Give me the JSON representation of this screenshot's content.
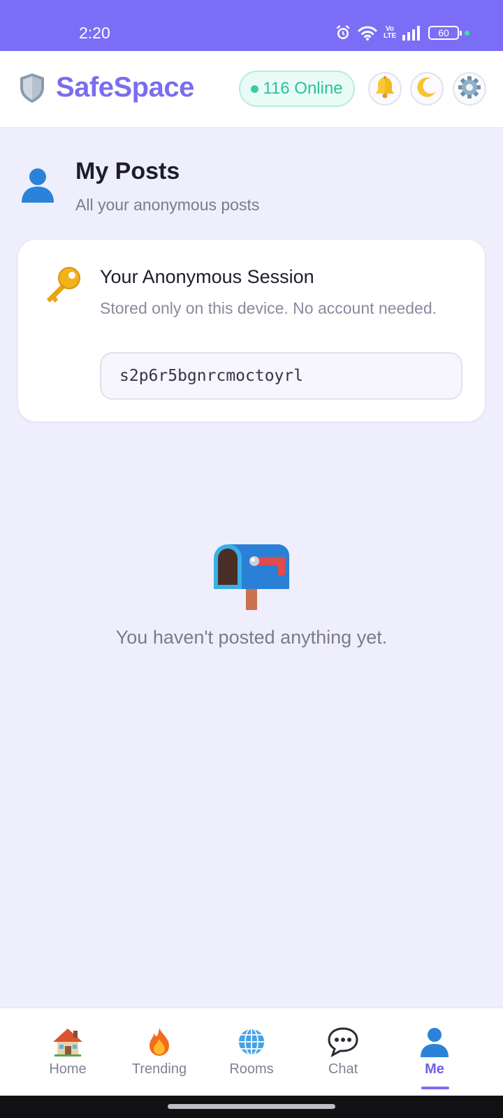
{
  "status_bar": {
    "time": "2:20",
    "network_label": "Vo LTE",
    "battery": "60",
    "icons": [
      "alarm-icon",
      "wifi-icon",
      "volte-icon",
      "signal-icon",
      "battery-icon"
    ]
  },
  "header": {
    "app_name": "SafeSpace",
    "online_count_label": "116 Online",
    "buttons": [
      "bell-icon",
      "moon-icon",
      "gear-icon"
    ],
    "colors": {
      "brand": "#7b6cf0",
      "status_bar": "#7b6ef6",
      "online": "#2fbf9b"
    }
  },
  "page": {
    "title": "My Posts",
    "subtitle": "All your anonymous posts"
  },
  "session": {
    "title": "Your Anonymous Session",
    "description": "Stored only on this device. No account needed.",
    "session_id": "s2p6r5bgnrcmoctoyrl"
  },
  "empty_state": {
    "message": "You haven't posted anything yet."
  },
  "bottom_nav": {
    "active": "Me",
    "items": [
      {
        "label": "Home",
        "icon": "house-icon"
      },
      {
        "label": "Trending",
        "icon": "fire-icon"
      },
      {
        "label": "Rooms",
        "icon": "globe-icon"
      },
      {
        "label": "Chat",
        "icon": "speech-bubble-icon"
      },
      {
        "label": "Me",
        "icon": "user-icon"
      }
    ]
  }
}
